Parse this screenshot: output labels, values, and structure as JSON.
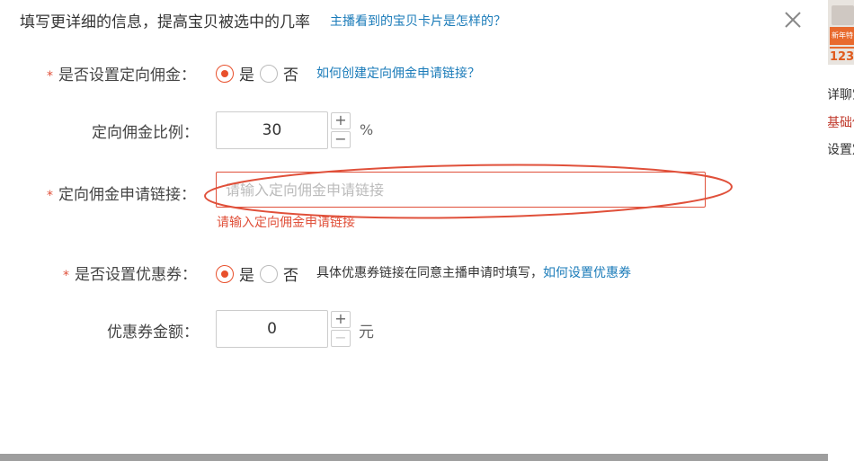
{
  "background": {
    "thumb_promo": "新年特",
    "thumb_number": "123",
    "side_texts": [
      "详聊宝",
      "基础佣",
      "设置定"
    ]
  },
  "dialog": {
    "title": "填写更详细的信息，提高宝贝被选中的几率",
    "title_link": "主播看到的宝贝卡片是怎样的？",
    "close_icon": "close-icon"
  },
  "form": {
    "required_mark": "*",
    "commission": {
      "label": "是否设置定向佣金：",
      "options": [
        "是",
        "否"
      ],
      "selected": "是",
      "help_link": "如何创建定向佣金申请链接？"
    },
    "ratio": {
      "label": "定向佣金比例：",
      "value": "30",
      "unit": "%",
      "increment": "+",
      "decrement": "−"
    },
    "apply_link": {
      "label": "定向佣金申请链接：",
      "placeholder": "请输入定向佣金申请链接",
      "value": "",
      "error": "请输入定向佣金申请链接"
    },
    "coupon": {
      "label": "是否设置优惠券：",
      "options": [
        "是",
        "否"
      ],
      "selected": "是",
      "help_text": "具体优惠券链接在同意主播申请时填写，",
      "help_link": "如何设置优惠券"
    },
    "coupon_amount": {
      "label": "优惠券金额：",
      "value": "0",
      "unit": "元",
      "increment": "+",
      "decrement": "−"
    }
  },
  "colors": {
    "accent": "#e8502c",
    "link": "#1a7bb9",
    "error": "#e0503a",
    "annotation": "#e0503a"
  }
}
